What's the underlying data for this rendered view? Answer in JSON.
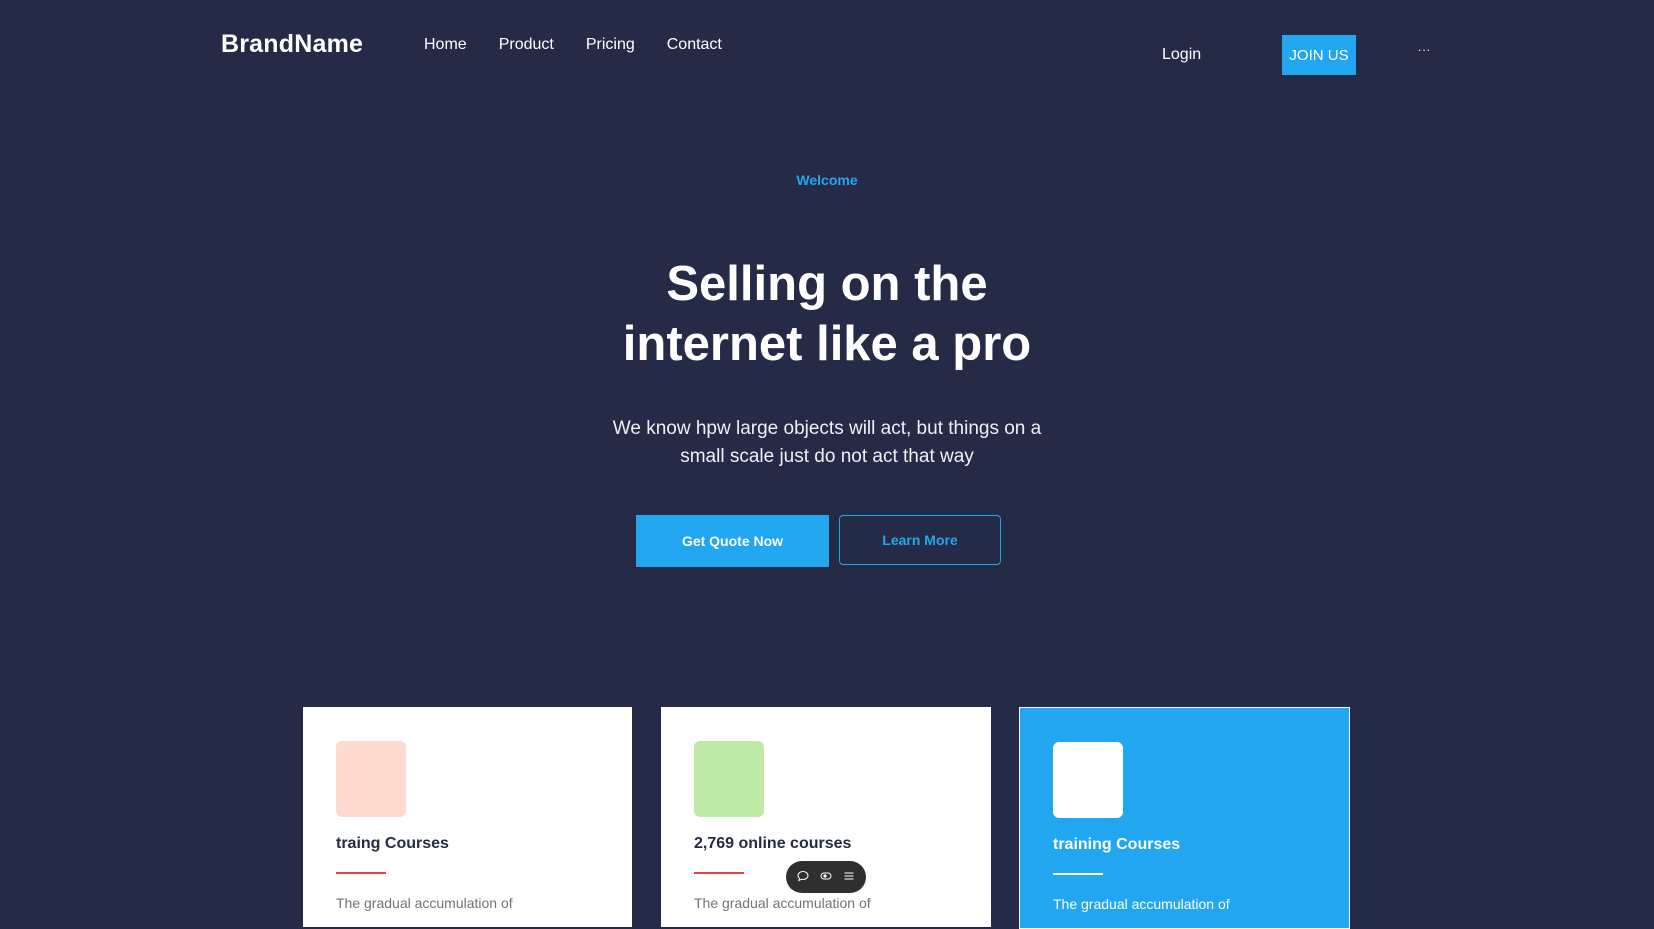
{
  "header": {
    "brand": "BrandName",
    "nav": [
      "Home",
      "Product",
      "Pricing",
      "Contact"
    ],
    "login": "Login",
    "join": "JOIN US",
    "more": "..."
  },
  "hero": {
    "eyebrow": "Welcome",
    "title_line1": "Selling on the",
    "title_line2": "internet like a pro",
    "subtitle_line1": "We know hpw large objects will act, but things on a",
    "subtitle_line2": "small scale just do not act that way",
    "primary_button": "Get Quote Now",
    "secondary_button": "Learn More"
  },
  "cards": [
    {
      "title": "traing Courses",
      "description": "The gradual accumulation of",
      "icon_color": "#ffdad1",
      "line_color": "#e74040"
    },
    {
      "title": "2,769 online courses",
      "description": "The gradual accumulation of",
      "icon_color": "#bdeaa7",
      "line_color": "#e74040"
    },
    {
      "title": "training Courses",
      "description": "The gradual accumulation of",
      "icon_color": "#ffffff",
      "line_color": "#ffffff"
    }
  ],
  "floating_toolbar": {
    "icons": [
      "comment-icon",
      "toggle-icon",
      "menu-icon"
    ]
  },
  "colors": {
    "background": "#252b46",
    "accent": "#23a6f0",
    "heading": "#252b42",
    "muted": "#737373",
    "danger_line": "#e74040"
  }
}
